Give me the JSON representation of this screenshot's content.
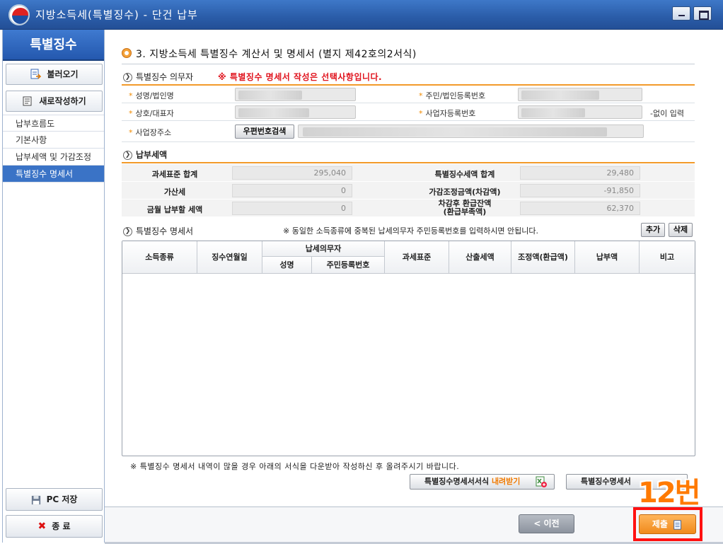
{
  "window": {
    "title": "지방소득세(특별징수) - 단건 납부"
  },
  "sidebar": {
    "header": "특별징수",
    "load_button": "불러오기",
    "new_button": "새로작성하기",
    "items": [
      {
        "label": "납부흐름도"
      },
      {
        "label": "기본사항"
      },
      {
        "label": "납부세액 및 가감조정"
      },
      {
        "label": "특별징수 명세서"
      }
    ],
    "save_button": "PC 저장",
    "exit_button": "종 료"
  },
  "section": {
    "title": "3. 지방소득세 특별징수 계산서 및 명세서 (별지 제42호의2서식)"
  },
  "obligor": {
    "heading": "특별징수 의무자",
    "notice": "※ 특별징수 명세서 작성은 선택사항입니다.",
    "name_label": "성명/법인명",
    "resident_label": "주민/법인등록번호",
    "rep_label": "상호/대표자",
    "bizno_label": "사업자등록번호",
    "bizno_hint": "-없이 입력",
    "address_label": "사업장주소",
    "zip_button": "우편번호검색"
  },
  "tax": {
    "heading": "납부세액",
    "rows": [
      {
        "l1": "과세표준 합계",
        "v1": "295,040",
        "l2": "특별징수세액 합계",
        "v2": "29,480"
      },
      {
        "l1": "가산세",
        "v1": "0",
        "l2": "가감조정금액(차감액)",
        "v2": "-91,850"
      },
      {
        "l1": "금월 납부할 세액",
        "v1": "0",
        "l2": "차감후 환급잔액\n(환급부족액)",
        "v2": "62,370"
      }
    ]
  },
  "statement": {
    "heading": "특별징수 명세서",
    "notice": "※ 동일한 소득종류에 중복된 납세의무자 주민등록번호를 입력하시면 안됩니다.",
    "add_button": "추가",
    "delete_button": "삭제",
    "columns": {
      "income_type": "소득종류",
      "period": "징수연월일",
      "taxpayer": "납세의무자",
      "name": "성명",
      "resident_no": "주민등록번호",
      "tax_base": "과세표준",
      "calc_tax": "산출세액",
      "adjust": "조정액(환급액)",
      "payment": "납부액",
      "remarks": "비고"
    },
    "bottom_note": "※ 특별징수 명세서 내역이 많을 경우 아래의 서식을 다운받아 작성하신 후 올려주시기 바랍니다.",
    "download_label": "특별징수명세서서식",
    "download_accent": "내려받기",
    "upload_label": "특별징수명세서"
  },
  "overlay": {
    "step": "12번"
  },
  "footer": {
    "prev_button": "< 이전",
    "submit_button": "제출"
  }
}
